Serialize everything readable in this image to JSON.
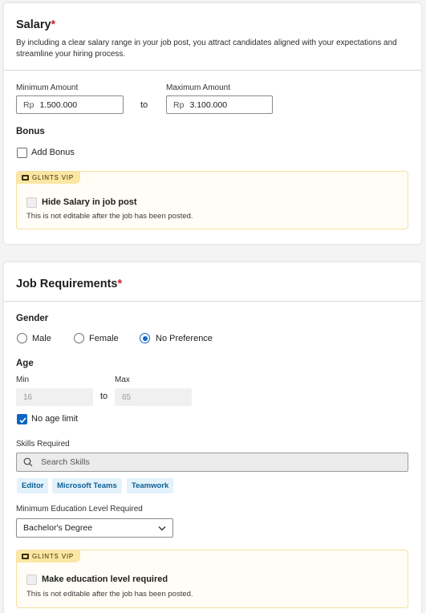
{
  "salary": {
    "title": "Salary",
    "required_mark": "*",
    "description": "By including a clear salary range in your job post, you attract candidates aligned with your expectations and streamline your hiring process.",
    "min_label": "Minimum Amount",
    "max_label": "Maximum Amount",
    "currency": "Rp",
    "min_value": "1.500.000",
    "max_value": "3.100.000",
    "to_label": "to",
    "bonus_label": "Bonus",
    "add_bonus_label": "Add Bonus",
    "vip_badge": "GLINTS VIP",
    "hide_salary_label": "Hide Salary in job post",
    "vip_note": "This is not editable after the job has been posted."
  },
  "requirements": {
    "title": "Job Requirements",
    "required_mark": "*",
    "gender_label": "Gender",
    "gender_options": [
      "Male",
      "Female",
      "No Preference"
    ],
    "gender_selected": "No Preference",
    "age_label": "Age",
    "min_label": "Min",
    "max_label": "Max",
    "min_value": "16",
    "max_value": "65",
    "to_label": "to",
    "no_age_limit_label": "No age limit",
    "no_age_limit_checked": true,
    "skills_label": "Skills Required",
    "search_placeholder": "Search Skills",
    "skills": [
      "Editor",
      "Microsoft Teams",
      "Teamwork"
    ],
    "education_label": "Minimum Education Level Required",
    "education_value": "Bachelor's Degree",
    "vip_badge": "GLINTS VIP",
    "education_required_label": "Make education level required",
    "vip_note": "This is not editable after the job has been posted."
  },
  "colors": {
    "accent": "#0b66c3",
    "required": "#d1212b",
    "vip_badge_bg": "#fbe7a3",
    "chip_bg": "#e3f2fb",
    "chip_text": "#0b5f93"
  },
  "icons": [
    "vip-icon",
    "search-icon",
    "chevron-down-icon",
    "check-icon"
  ]
}
